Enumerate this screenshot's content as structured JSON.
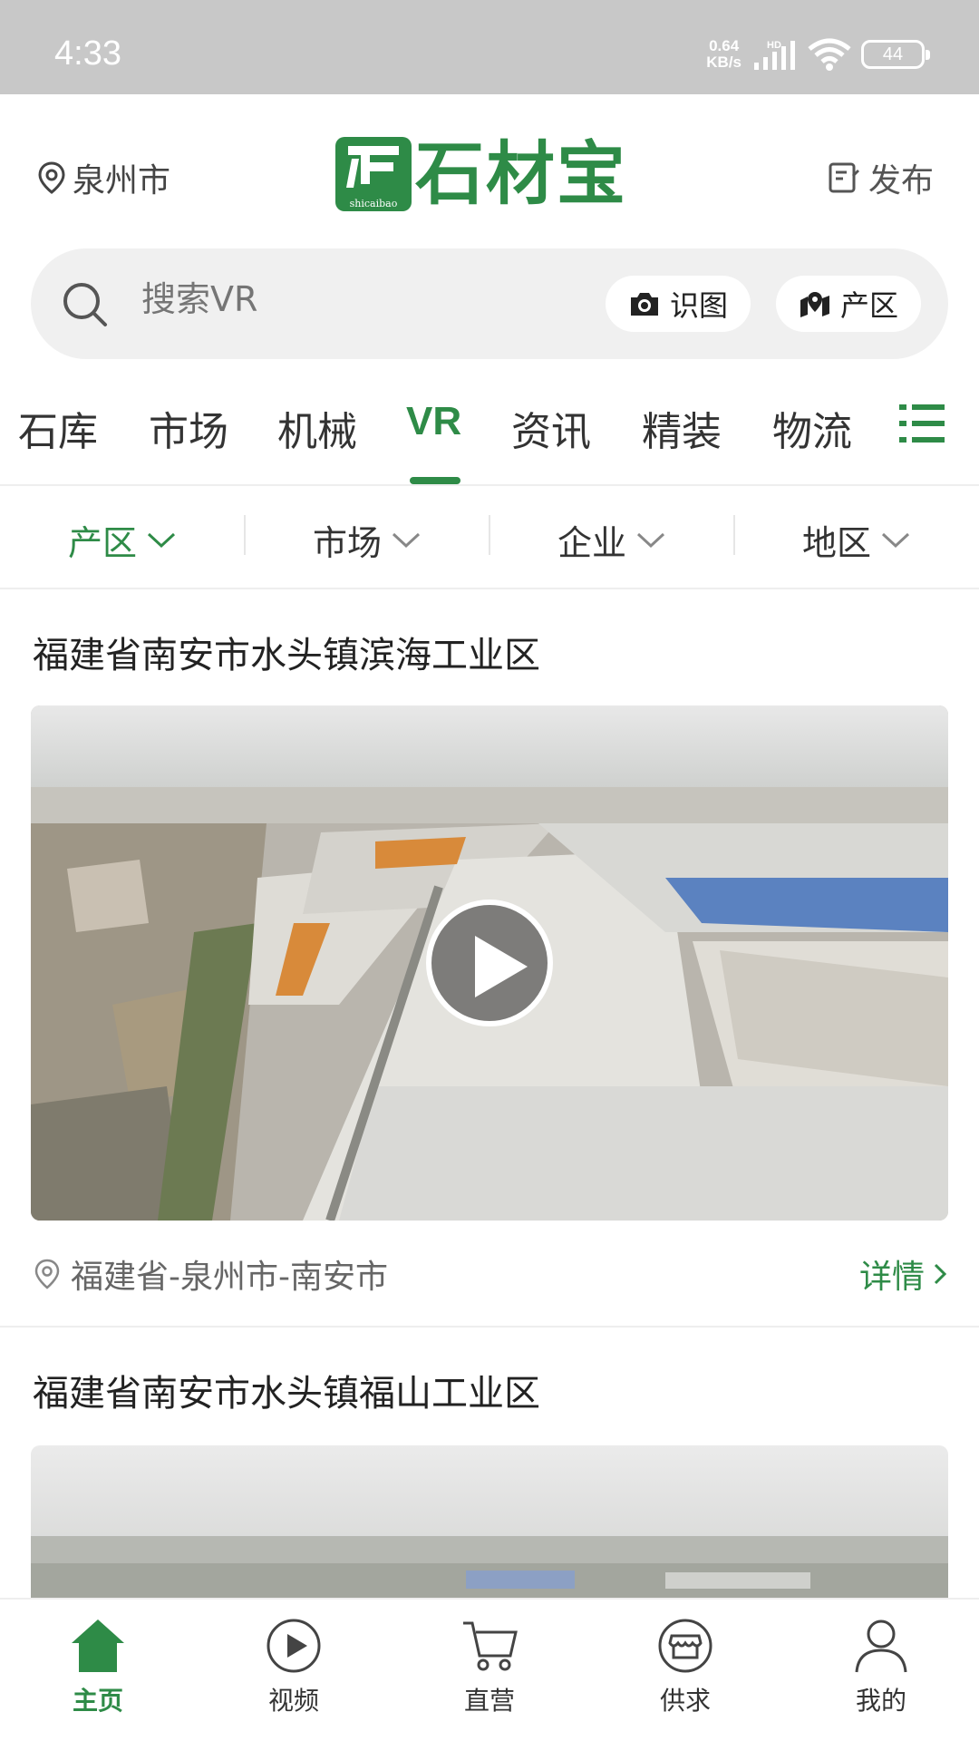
{
  "status_bar": {
    "time": "4:33",
    "net_speed_value": "0.64",
    "net_speed_unit": "KB/s",
    "network_type": "HD",
    "battery": "44"
  },
  "header": {
    "location": "泉州市",
    "logo_text": "石材宝",
    "logo_sub": "shicaibao",
    "publish_label": "发布"
  },
  "search": {
    "placeholder": "搜索VR",
    "image_search_label": "识图",
    "region_label": "产区"
  },
  "tabs": [
    {
      "label": "石库"
    },
    {
      "label": "市场"
    },
    {
      "label": "机械"
    },
    {
      "label": "VR"
    },
    {
      "label": "资讯"
    },
    {
      "label": "精装"
    },
    {
      "label": "物流"
    }
  ],
  "filters": [
    {
      "label": "产区"
    },
    {
      "label": "市场"
    },
    {
      "label": "企业"
    },
    {
      "label": "地区"
    }
  ],
  "cards": [
    {
      "title": "福建省南安市水头镇滨海工业区",
      "location": "福建省-泉州市-南安市",
      "detail_label": "详情"
    },
    {
      "title": "福建省南安市水头镇福山工业区"
    }
  ],
  "bottom_nav": [
    {
      "label": "主页"
    },
    {
      "label": "视频"
    },
    {
      "label": "直营"
    },
    {
      "label": "供求"
    },
    {
      "label": "我的"
    }
  ],
  "colors": {
    "accent": "#2e8b47",
    "status_bar": "#c8c8c8",
    "search_bg": "#f0f0f0"
  }
}
